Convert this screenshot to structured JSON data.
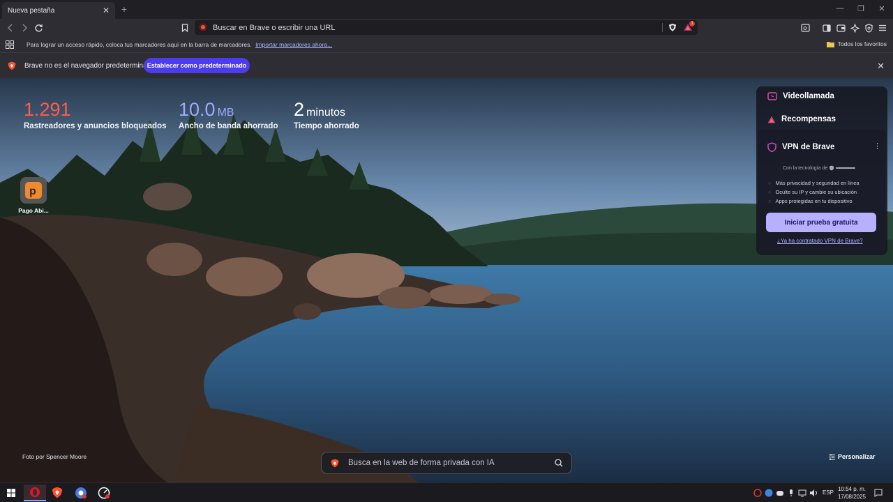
{
  "tab": {
    "title": "Nueva pestaña"
  },
  "omnibox": {
    "placeholder": "Buscar en Brave o escribir una URL",
    "shields_badge": "1"
  },
  "bookmarks_bar": {
    "message": "Para lograr un acceso rápido, coloca tus marcadores aquí en la barra de marcadores.",
    "import_link": "Importar marcadores ahora...",
    "all_favorites": "Todos los favoritos"
  },
  "infobar": {
    "message": "Brave no es el navegador predeterminado",
    "set_default": "Establecer como predeterminado"
  },
  "stats": [
    {
      "value": "1.291",
      "unit": "",
      "label": "Rastreadores y anuncios bloqueados",
      "color": "#ff5b4a"
    },
    {
      "value": "10.0",
      "unit": "MB",
      "label": "Ancho de banda ahorrado",
      "color": "#9ea9ff"
    },
    {
      "value": "2",
      "unit": "minutos",
      "label": "Tiempo ahorrado",
      "color": "#ffffff"
    }
  ],
  "top_sites": [
    {
      "label": "Pago Abi..."
    }
  ],
  "widget": {
    "videocall": "Videollamada",
    "rewards": "Recompensas",
    "vpn_title": "VPN de Brave",
    "powered_by": "Con la tecnología de",
    "features": [
      "Más privacidad y seguridad en línea",
      "Oculte su IP y cambie su ubicación",
      "Apps protegidas en tu dispositivo"
    ],
    "cta": "Iniciar prueba gratuita",
    "existing": "¿Ya ha contratado VPN de Brave?"
  },
  "photo_credit": "Foto por Spencer Moore",
  "search_placeholder": "Busca en la web de forma privada con IA",
  "customize": "Personalizar",
  "taskbar": {
    "lang": "ESP",
    "time": "10:54 p. m.",
    "date": "17/08/2025"
  },
  "colors": {
    "accent": "#4c3cf0",
    "vpn_cta": "#b7b0ff",
    "brave_orange": "#fb542b"
  }
}
